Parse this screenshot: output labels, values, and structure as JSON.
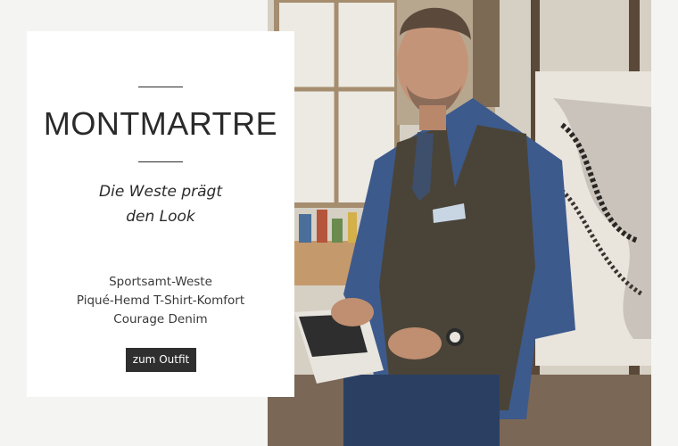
{
  "promo": {
    "title": "MONTMARTRE",
    "tagline_line1": "Die Weste prägt",
    "tagline_line2": "den Look",
    "products": [
      "Sportsamt-Weste",
      "Piqué-Hemd T-Shirt-Komfort",
      "Courage Denim"
    ],
    "cta_label": "zum Outfit"
  }
}
